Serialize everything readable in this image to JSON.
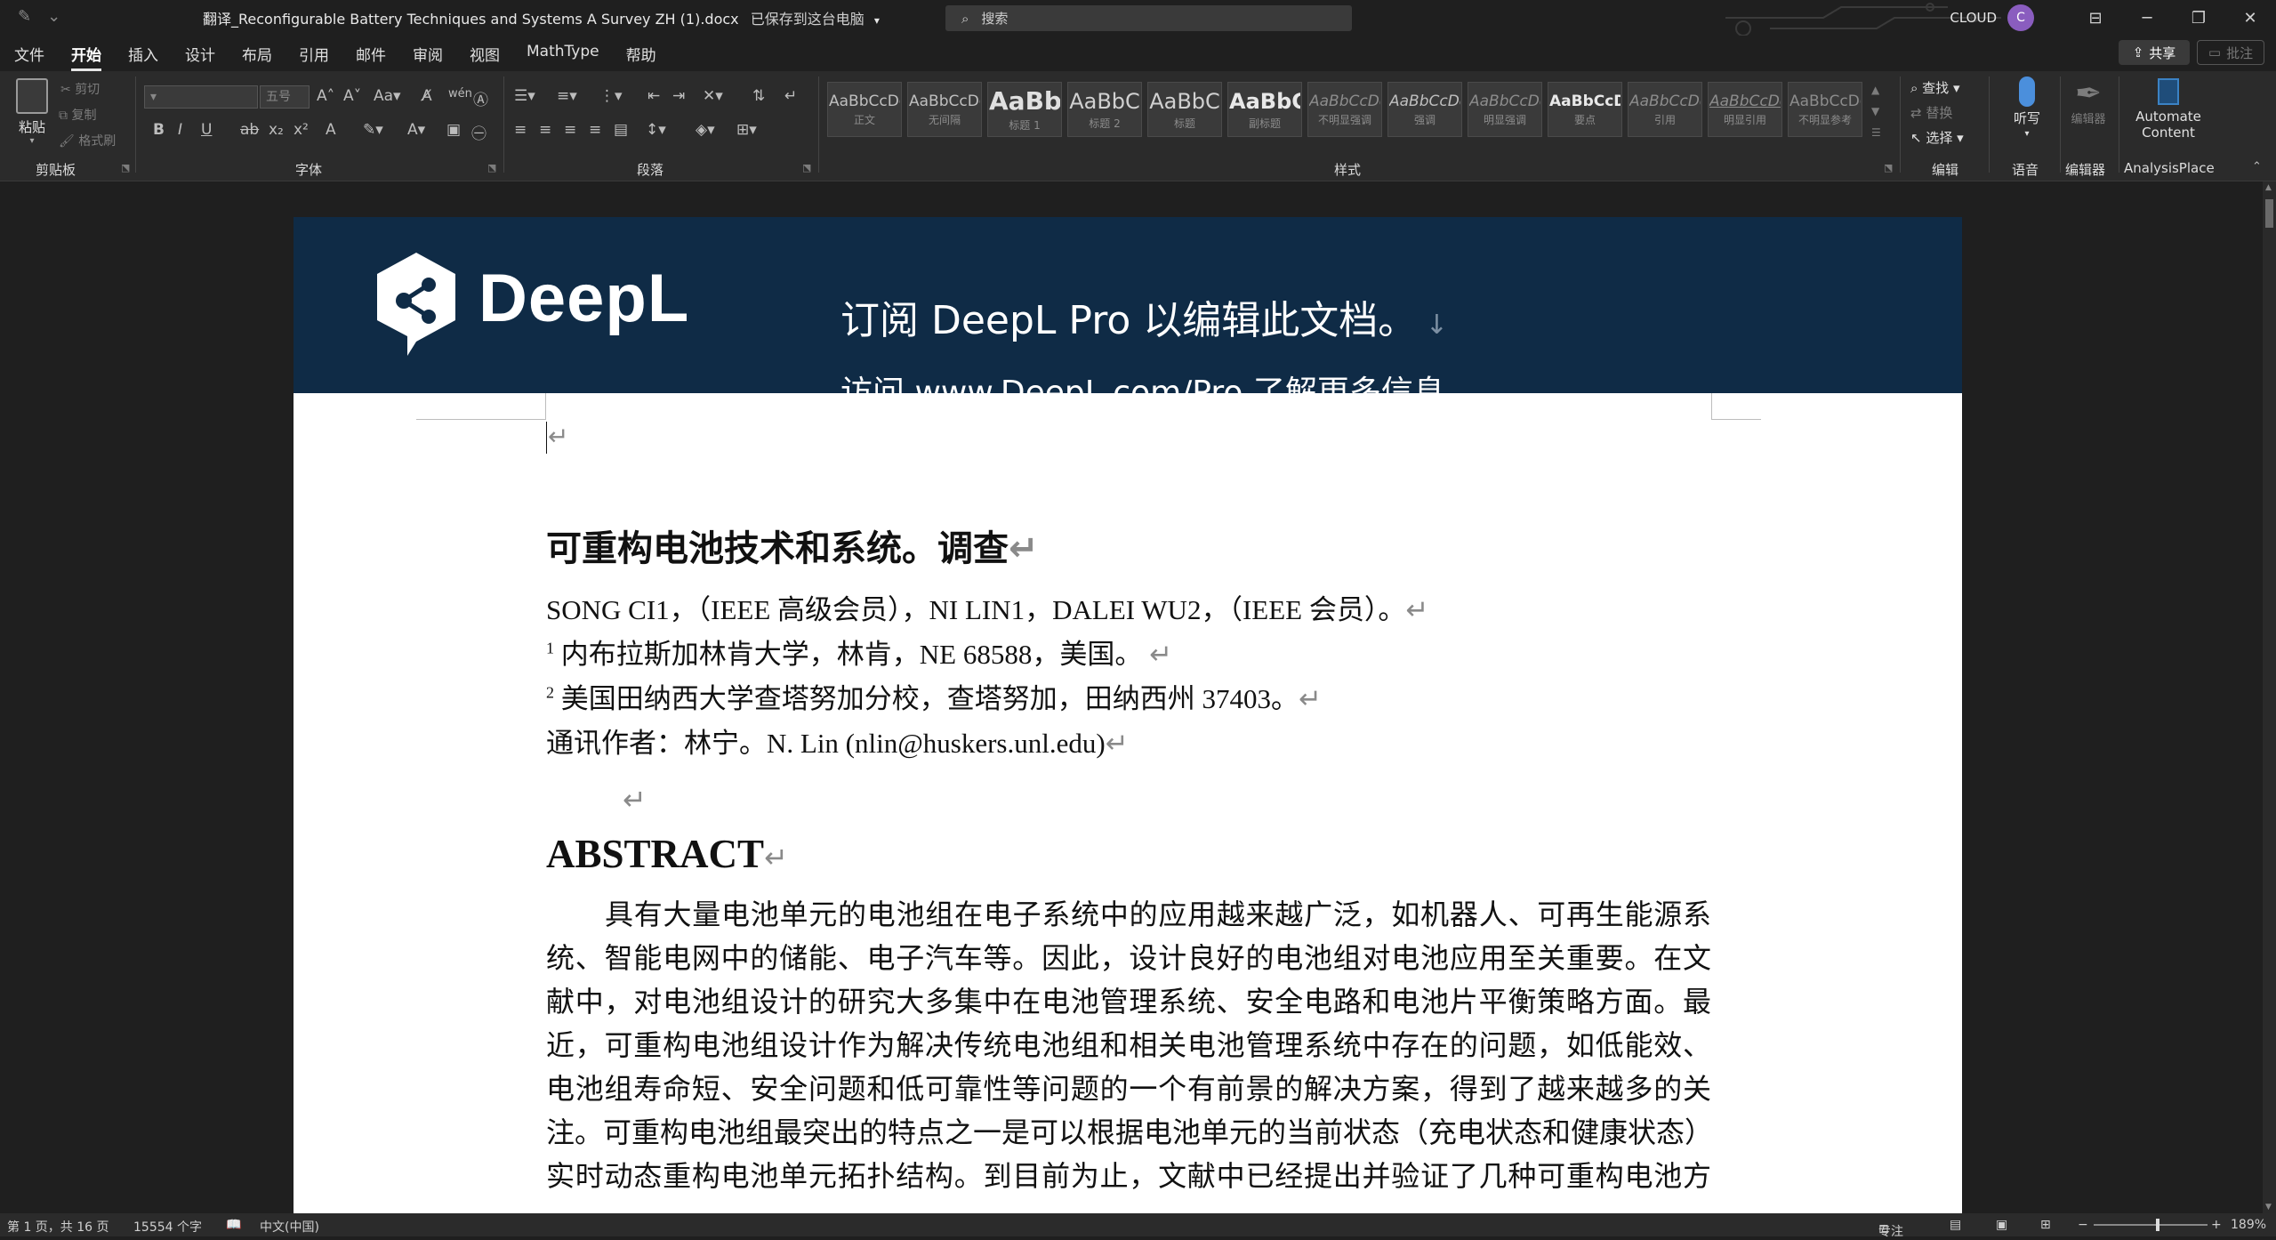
{
  "titlebar": {
    "doc_title": "翻译_Reconfigurable Battery Techniques and Systems A Survey ZH (1).docx",
    "save_status": "已保存到这台电脑",
    "search_placeholder": "搜索",
    "user_label": "CLOUD",
    "avatar_initial": "C"
  },
  "menu": {
    "items": [
      "文件",
      "开始",
      "插入",
      "设计",
      "布局",
      "引用",
      "邮件",
      "审阅",
      "视图",
      "MathType",
      "帮助"
    ],
    "active": "开始",
    "share_label": "共享",
    "comment_label": "批注"
  },
  "ribbon": {
    "clipboard": {
      "label": "剪贴板",
      "paste": "粘贴",
      "cut": "剪切",
      "copy": "复制",
      "format_painter": "格式刷"
    },
    "font": {
      "label": "字体",
      "size": "五号"
    },
    "paragraph": {
      "label": "段落"
    },
    "styles": {
      "label": "样式",
      "items": [
        {
          "sample": "AaBbCcDd",
          "name": "正文"
        },
        {
          "sample": "AaBbCcDd",
          "name": "无间隔"
        },
        {
          "sample": "AaBb",
          "name": "标题 1"
        },
        {
          "sample": "AaBbC",
          "name": "标题 2"
        },
        {
          "sample": "AaBbC",
          "name": "标题"
        },
        {
          "sample": "AaBbC",
          "name": "副标题"
        },
        {
          "sample": "AaBbCcDd",
          "name": "不明显强调"
        },
        {
          "sample": "AaBbCcDd",
          "name": "强调"
        },
        {
          "sample": "AaBbCcDd",
          "name": "明显强调"
        },
        {
          "sample": "AaBbCcD",
          "name": "要点"
        },
        {
          "sample": "AaBbCcDd",
          "name": "引用"
        },
        {
          "sample": "AaBbCcDd",
          "name": "明显引用"
        },
        {
          "sample": "AaBbCcDd",
          "name": "不明显参考"
        }
      ]
    },
    "editing": {
      "label": "编辑",
      "find": "查找",
      "replace": "替换",
      "select": "选择"
    },
    "voice": {
      "label": "语音",
      "dictate": "听写"
    },
    "editor": {
      "label": "编辑器",
      "button": "编辑器"
    },
    "analysis": {
      "label": "AnalysisPlace",
      "button_line1": "Automate",
      "button_line2": "Content"
    }
  },
  "document": {
    "banner": {
      "logo_text": "DeepL",
      "main_text": "订阅 DeepL Pro 以编辑此文档。",
      "sub_text": "访问 www.DeepL.com/Pro 了解更多信息。"
    },
    "title": "可重构电池技术和系统。调查",
    "authors": "SONG CI1，（IEEE 高级会员），NI LIN1，DALEI WU2，（IEEE 会员）。",
    "affil1_sup": "1",
    "affil1": "内布拉斯加林肯大学，林肯，NE 68588，美国。",
    "affil2_sup": "2",
    "affil2": "美国田纳西大学查塔努加分校，查塔努加，田纳西州 37403。",
    "corresponding": "通讯作者：林宁。N. Lin (nlin@huskers.unl.edu)",
    "abstract_heading": "ABSTRACT",
    "abstract_lines": [
      "具有大量电池单元的电池组在电子系统中的应用越来越广泛，如机器人、可再生能源系",
      "统、智能电网中的储能、电子汽车等。因此，设计良好的电池组对电池应用至关重要。在文",
      "献中，对电池组设计的研究大多集中在电池管理系统、安全电路和电池片平衡策略方面。最",
      "近，可重构电池组设计作为解决传统电池组和相关电池管理系统中存在的问题，如低能效、",
      "电池组寿命短、安全问题和低可靠性等问题的一个有前景的解决方案，得到了越来越多的关",
      "注。可重构电池组最突出的特点之一是可以根据电池单元的当前状态（充电状态和健康状态）",
      "实时动态重构电池单元拓扑结构。到目前为止，文献中已经提出并验证了几种可重构电池方"
    ],
    "return_mark": "↵"
  },
  "status": {
    "page": "第 1 页，共 16 页",
    "words": "15554 个字",
    "language": "中文(中国)",
    "focus": "专注",
    "zoom": "189%"
  },
  "colors": {
    "app_bg": "#1f1f1f",
    "ribbon_bg": "#2b2b2b",
    "banner_bg": "#0f2b46",
    "avatar": "#8a5dbf"
  }
}
